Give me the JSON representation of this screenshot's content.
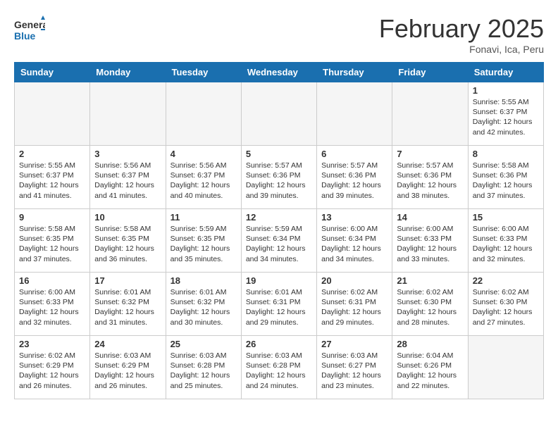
{
  "header": {
    "logo": {
      "general": "General",
      "blue": "Blue"
    },
    "month": "February 2025",
    "location": "Fonavi, Ica, Peru"
  },
  "days_of_week": [
    "Sunday",
    "Monday",
    "Tuesday",
    "Wednesday",
    "Thursday",
    "Friday",
    "Saturday"
  ],
  "weeks": [
    [
      {
        "day": "",
        "info": ""
      },
      {
        "day": "",
        "info": ""
      },
      {
        "day": "",
        "info": ""
      },
      {
        "day": "",
        "info": ""
      },
      {
        "day": "",
        "info": ""
      },
      {
        "day": "",
        "info": ""
      },
      {
        "day": "1",
        "info": "Sunrise: 5:55 AM\nSunset: 6:37 PM\nDaylight: 12 hours\nand 42 minutes."
      }
    ],
    [
      {
        "day": "2",
        "info": "Sunrise: 5:55 AM\nSunset: 6:37 PM\nDaylight: 12 hours\nand 41 minutes."
      },
      {
        "day": "3",
        "info": "Sunrise: 5:56 AM\nSunset: 6:37 PM\nDaylight: 12 hours\nand 41 minutes."
      },
      {
        "day": "4",
        "info": "Sunrise: 5:56 AM\nSunset: 6:37 PM\nDaylight: 12 hours\nand 40 minutes."
      },
      {
        "day": "5",
        "info": "Sunrise: 5:57 AM\nSunset: 6:36 PM\nDaylight: 12 hours\nand 39 minutes."
      },
      {
        "day": "6",
        "info": "Sunrise: 5:57 AM\nSunset: 6:36 PM\nDaylight: 12 hours\nand 39 minutes."
      },
      {
        "day": "7",
        "info": "Sunrise: 5:57 AM\nSunset: 6:36 PM\nDaylight: 12 hours\nand 38 minutes."
      },
      {
        "day": "8",
        "info": "Sunrise: 5:58 AM\nSunset: 6:36 PM\nDaylight: 12 hours\nand 37 minutes."
      }
    ],
    [
      {
        "day": "9",
        "info": "Sunrise: 5:58 AM\nSunset: 6:35 PM\nDaylight: 12 hours\nand 37 minutes."
      },
      {
        "day": "10",
        "info": "Sunrise: 5:58 AM\nSunset: 6:35 PM\nDaylight: 12 hours\nand 36 minutes."
      },
      {
        "day": "11",
        "info": "Sunrise: 5:59 AM\nSunset: 6:35 PM\nDaylight: 12 hours\nand 35 minutes."
      },
      {
        "day": "12",
        "info": "Sunrise: 5:59 AM\nSunset: 6:34 PM\nDaylight: 12 hours\nand 34 minutes."
      },
      {
        "day": "13",
        "info": "Sunrise: 6:00 AM\nSunset: 6:34 PM\nDaylight: 12 hours\nand 34 minutes."
      },
      {
        "day": "14",
        "info": "Sunrise: 6:00 AM\nSunset: 6:33 PM\nDaylight: 12 hours\nand 33 minutes."
      },
      {
        "day": "15",
        "info": "Sunrise: 6:00 AM\nSunset: 6:33 PM\nDaylight: 12 hours\nand 32 minutes."
      }
    ],
    [
      {
        "day": "16",
        "info": "Sunrise: 6:00 AM\nSunset: 6:33 PM\nDaylight: 12 hours\nand 32 minutes."
      },
      {
        "day": "17",
        "info": "Sunrise: 6:01 AM\nSunset: 6:32 PM\nDaylight: 12 hours\nand 31 minutes."
      },
      {
        "day": "18",
        "info": "Sunrise: 6:01 AM\nSunset: 6:32 PM\nDaylight: 12 hours\nand 30 minutes."
      },
      {
        "day": "19",
        "info": "Sunrise: 6:01 AM\nSunset: 6:31 PM\nDaylight: 12 hours\nand 29 minutes."
      },
      {
        "day": "20",
        "info": "Sunrise: 6:02 AM\nSunset: 6:31 PM\nDaylight: 12 hours\nand 29 minutes."
      },
      {
        "day": "21",
        "info": "Sunrise: 6:02 AM\nSunset: 6:30 PM\nDaylight: 12 hours\nand 28 minutes."
      },
      {
        "day": "22",
        "info": "Sunrise: 6:02 AM\nSunset: 6:30 PM\nDaylight: 12 hours\nand 27 minutes."
      }
    ],
    [
      {
        "day": "23",
        "info": "Sunrise: 6:02 AM\nSunset: 6:29 PM\nDaylight: 12 hours\nand 26 minutes."
      },
      {
        "day": "24",
        "info": "Sunrise: 6:03 AM\nSunset: 6:29 PM\nDaylight: 12 hours\nand 26 minutes."
      },
      {
        "day": "25",
        "info": "Sunrise: 6:03 AM\nSunset: 6:28 PM\nDaylight: 12 hours\nand 25 minutes."
      },
      {
        "day": "26",
        "info": "Sunrise: 6:03 AM\nSunset: 6:28 PM\nDaylight: 12 hours\nand 24 minutes."
      },
      {
        "day": "27",
        "info": "Sunrise: 6:03 AM\nSunset: 6:27 PM\nDaylight: 12 hours\nand 23 minutes."
      },
      {
        "day": "28",
        "info": "Sunrise: 6:04 AM\nSunset: 6:26 PM\nDaylight: 12 hours\nand 22 minutes."
      },
      {
        "day": "",
        "info": ""
      }
    ]
  ]
}
